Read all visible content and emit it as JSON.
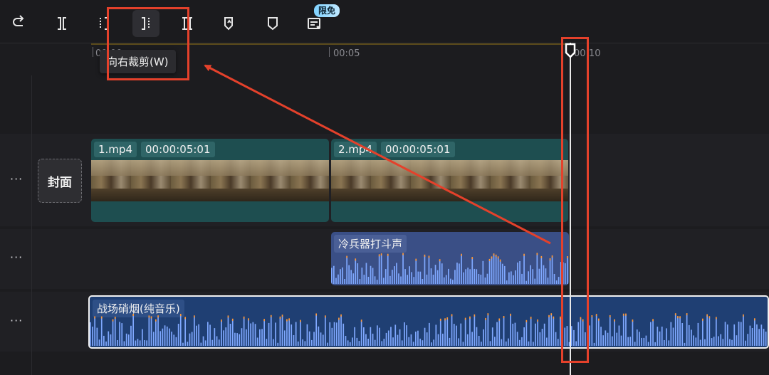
{
  "toolbar": {
    "buttons": [
      {
        "name": "undo-icon",
        "label": "undo"
      },
      {
        "name": "split-icon",
        "label": "split"
      },
      {
        "name": "trim-left-icon",
        "label": "trim left"
      },
      {
        "name": "trim-right-icon",
        "label": "trim right"
      },
      {
        "name": "delete-icon",
        "label": "delete"
      },
      {
        "name": "ai-marker-icon",
        "label": "ai marker"
      },
      {
        "name": "marker-icon",
        "label": "marker"
      },
      {
        "name": "auto-caption-icon",
        "label": "captions"
      }
    ],
    "badge": "限免"
  },
  "tooltip": "向右裁剪(W)",
  "ruler": {
    "ticks": [
      "00:00",
      "00:05",
      "00:10"
    ]
  },
  "tracks": {
    "cover_label": "封面",
    "dots": "···",
    "video_clips": [
      {
        "name": "1.mp4",
        "duration": "00:00:05:01"
      },
      {
        "name": "2.mp4",
        "duration": "00:00:05:01"
      }
    ],
    "sfx_clip": {
      "name": "冷兵器打斗声"
    },
    "music_clip": {
      "name": "战场硝烟(纯音乐)"
    }
  },
  "colors": {
    "highlight": "#e4412b",
    "video_clip": "#1e4e50",
    "sfx_clip": "#3a4f86",
    "music_clip": "#1f3f73",
    "wave": "#7fa8ff",
    "wave_peak": "#ff9a3a"
  }
}
